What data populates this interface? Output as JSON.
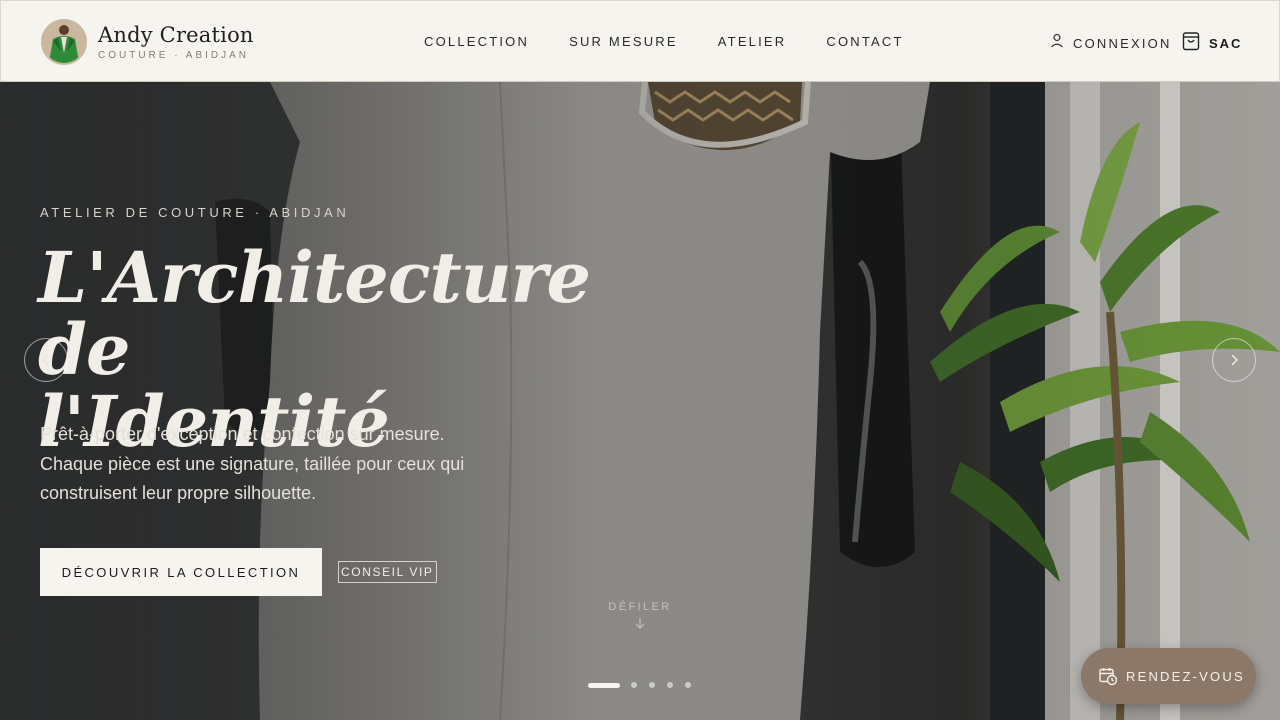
{
  "brand": {
    "name": "Andy Creation",
    "subtitle": "COUTURE · ABIDJAN",
    "logo_icon": "avatar-green-jacket"
  },
  "nav": {
    "items": [
      {
        "label": "COLLECTION"
      },
      {
        "label": "SUR MESURE"
      },
      {
        "label": "ATELIER"
      },
      {
        "label": "CONTACT"
      }
    ]
  },
  "header_actions": {
    "login_label": "CONNEXION",
    "login_icon": "user-icon",
    "bag_label": "SAC",
    "bag_icon": "shopping-bag-icon"
  },
  "hero": {
    "eyebrow": "ATELIER DE COUTURE · ABIDJAN",
    "headline_line1": "L'Architecture de",
    "headline_line2": "l'Identité",
    "subtext": "Prêt-à-porter d'exception et confection sur mesure. Chaque pièce est une signature, taillée pour ceux qui construisent leur propre silhouette.",
    "primary_cta": "DÉCOUVRIR LA COLLECTION",
    "secondary_cta": "CONSEIL VIP",
    "scroll_label": "DÉFILER",
    "slides_total": 5,
    "active_slide": 1
  },
  "appointment": {
    "label": "RENDEZ-VOUS",
    "icon": "calendar-clock-icon"
  },
  "colors": {
    "header_bg": "#f5f4ef",
    "accent_brown": "#8c7868",
    "text_dark": "#1c1c1c"
  }
}
